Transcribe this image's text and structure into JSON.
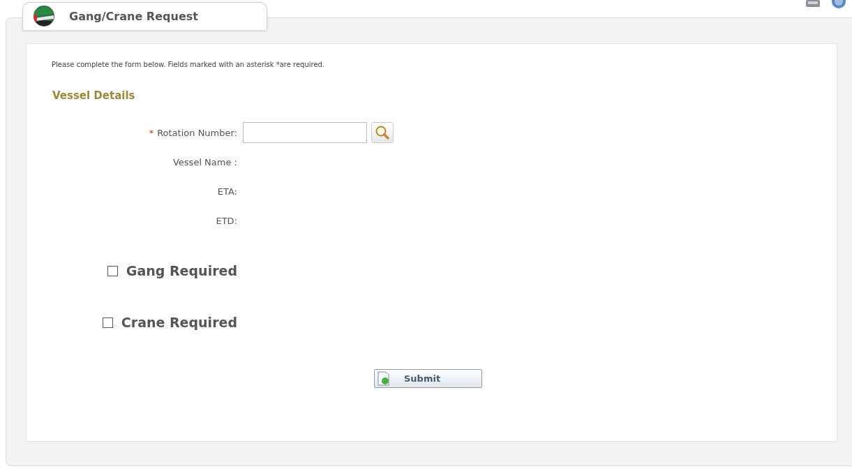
{
  "header": {
    "title": "Gang/Crane Request"
  },
  "instructions": "Please complete the form below. Fields marked with an asterisk *are required.",
  "section": {
    "title": "Vessel Details"
  },
  "fields": [
    {
      "kind": "input",
      "required_mark": "*",
      "label": "Rotation Number:"
    },
    {
      "kind": "text",
      "label": "Vessel Name :"
    },
    {
      "kind": "text",
      "label": "ETA:"
    },
    {
      "kind": "text",
      "label": "ETD:"
    }
  ],
  "checkboxes": [
    {
      "label": "Gang Required",
      "checked": false
    },
    {
      "label": "Crane Required",
      "checked": false
    }
  ],
  "submit": {
    "label": "Submit"
  }
}
